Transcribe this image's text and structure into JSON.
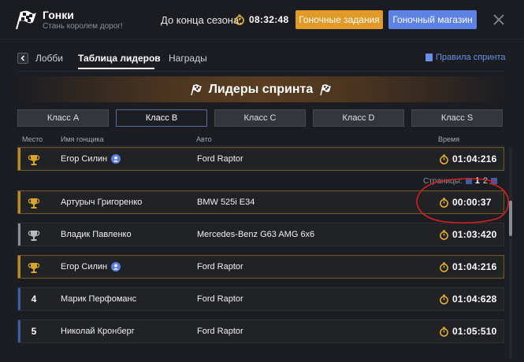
{
  "header": {
    "title": "Гонки",
    "subtitle": "Стань королем дорог!",
    "season_label": "До конца сезона:",
    "season_timer": "08:32:48",
    "race_tasks_button": "Гоночные задания",
    "race_shop_button": "Гоночный магазин"
  },
  "nav": {
    "tabs": [
      "Лобби",
      "Таблица лидеров",
      "Награды"
    ],
    "active_tab": "Таблица лидеров",
    "rules_link": "Правила спринта"
  },
  "banner": {
    "title": "Лидеры спринта"
  },
  "class_tabs": [
    "Класс A",
    "Класс B",
    "Класс C",
    "Класс D",
    "Класс S"
  ],
  "active_class": "Класс B",
  "columns": {
    "place": "Место",
    "name": "Имя гонщика",
    "car": "Авто",
    "time": "Время"
  },
  "pinned_row": {
    "place_icon": "gold-trophy-icon",
    "name": "Егор Силин",
    "verified": true,
    "car": "Ford Raptor",
    "time": "01:04:216"
  },
  "pagination": {
    "label": "Страницы:",
    "pages": [
      "1",
      "2"
    ],
    "current": "1"
  },
  "rows": [
    {
      "place_icon": "gold-trophy-icon",
      "name": "Артурыч Григоренко",
      "verified": false,
      "car": "BMW 525i  E34",
      "time": "00:00:37"
    },
    {
      "place_icon": "silver-trophy-icon",
      "name": "Владик Павленко",
      "verified": false,
      "car": "Mercedes-Benz G63 AMG 6x6",
      "time": "01:03:420"
    },
    {
      "place_icon": "gold-trophy-icon",
      "name": "Егор Силин",
      "verified": true,
      "car": "Ford Raptor",
      "time": "01:04:216"
    },
    {
      "place": "4",
      "name": "Марик Перфоманс",
      "verified": false,
      "car": "Ford Raptor",
      "time": "01:04:628"
    },
    {
      "place": "5",
      "name": "Николай Кронберг",
      "verified": false,
      "car": "Ford Raptor",
      "time": "01:05:510"
    }
  ],
  "colors": {
    "accent_orange": "#e19a28",
    "accent_blue": "#5c82e6",
    "gold": "#d9a62a",
    "silver": "#b8bcc2",
    "annotation_red": "#d42020"
  }
}
